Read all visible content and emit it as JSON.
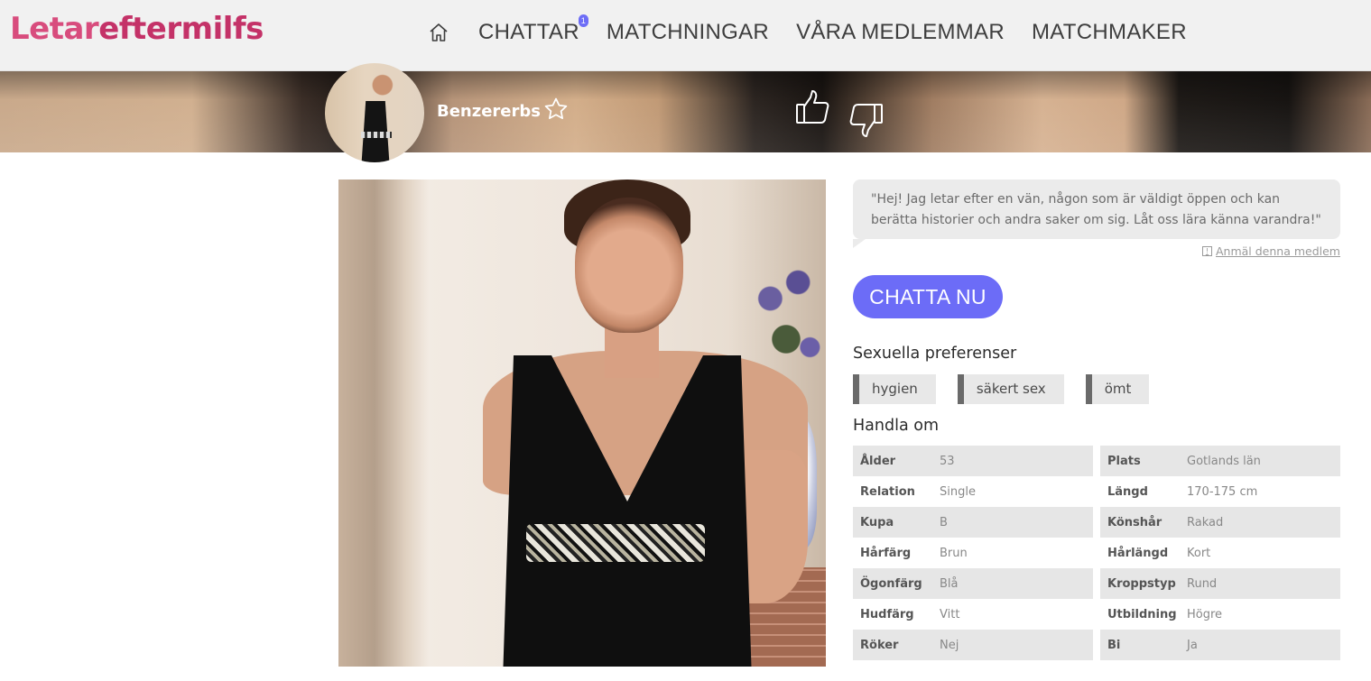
{
  "site": {
    "logo_part1": "Letar",
    "logo_part2": "eftermilfs"
  },
  "nav": {
    "items": [
      {
        "label": "CHATTAR",
        "badge": "1"
      },
      {
        "label": "MATCHNINGAR"
      },
      {
        "label": "VÅRA MEDLEMMAR"
      },
      {
        "label": "MATCHMAKER"
      }
    ]
  },
  "profile": {
    "username": "Benzererbs",
    "quote": "\"Hej! Jag letar efter en vän, någon som är väldigt öppen och kan berätta historier och andra saker om sig. Låt oss lära känna varandra!\"",
    "report_label": "Anmäl denna medlem",
    "chat_button": "CHATTA NU",
    "preferences_title": "Sexuella preferenser",
    "preferences": [
      "hygien",
      "säkert sex",
      "ömt"
    ],
    "about_title": "Handla om",
    "about_rows": [
      {
        "l1": "Ålder",
        "v1": "53",
        "l2": "Plats",
        "v2": "Gotlands län"
      },
      {
        "l1": "Relation",
        "v1": "Single",
        "l2": "Längd",
        "v2": "170-175 cm"
      },
      {
        "l1": "Kupa",
        "v1": "B",
        "l2": "Könshår",
        "v2": "Rakad"
      },
      {
        "l1": "Hårfärg",
        "v1": "Brun",
        "l2": "Hårlängd",
        "v2": "Kort"
      },
      {
        "l1": "Ögonfärg",
        "v1": "Blå",
        "l2": "Kroppstyp",
        "v2": "Rund"
      },
      {
        "l1": "Hudfärg",
        "v1": "Vitt",
        "l2": "Utbildning",
        "v2": "Högre"
      },
      {
        "l1": "Röker",
        "v1": "Nej",
        "l2": "Bi",
        "v2": "Ja"
      }
    ]
  },
  "colors": {
    "brand": "#cf3f72",
    "accent": "#6c6cf7",
    "tag_border": "#6a6a6a"
  }
}
